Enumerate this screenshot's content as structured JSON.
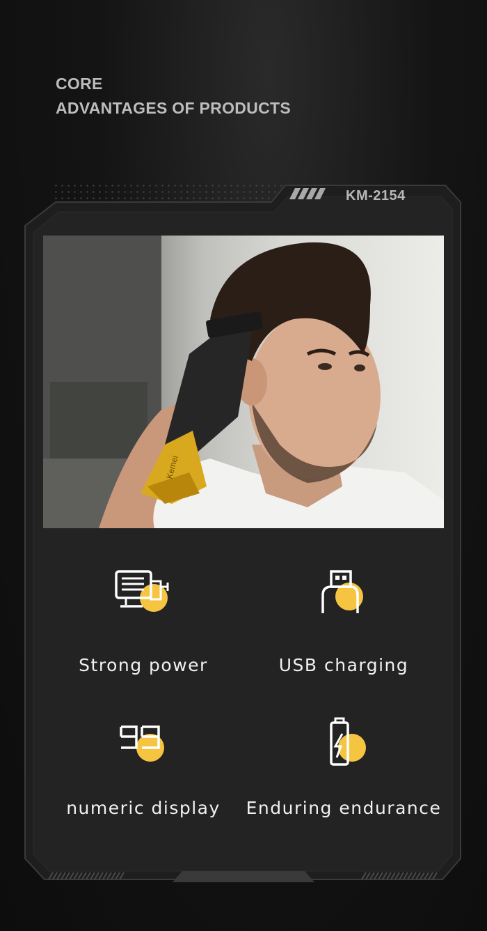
{
  "heading": {
    "line1": "CORE",
    "line2": "ADVANTAGES OF PRODUCTS"
  },
  "model": "KM-2154",
  "photo": {
    "device_brand": "Kemei"
  },
  "features": [
    {
      "icon": "motor-power-icon",
      "label": "Strong power"
    },
    {
      "icon": "usb-plug-icon",
      "label": "USB charging"
    },
    {
      "icon": "digital-99-display-icon",
      "label": "numeric display"
    },
    {
      "icon": "battery-charge-icon",
      "label": "Enduring endurance"
    }
  ],
  "colors": {
    "accent": "#f5c542",
    "panel": "#232323",
    "frame_edge": "#3a3a3a",
    "text": "#f1f1f1"
  }
}
